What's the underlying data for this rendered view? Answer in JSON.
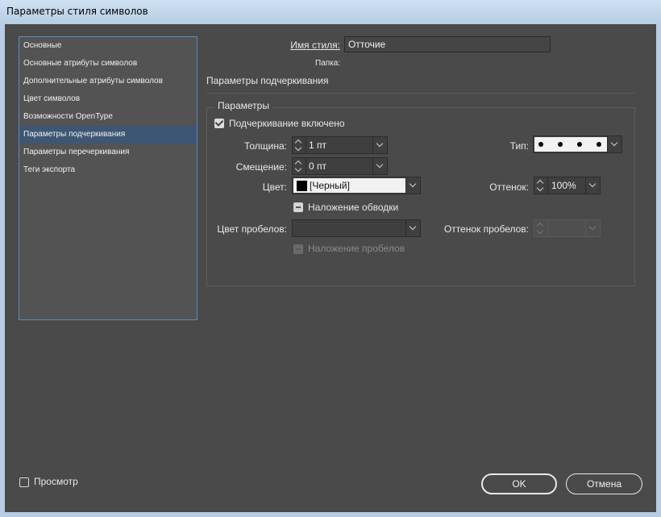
{
  "window": {
    "title": "Параметры стиля символов"
  },
  "sidebar": {
    "items": [
      {
        "label": "Основные",
        "selected": false
      },
      {
        "label": "Основные атрибуты символов",
        "selected": false
      },
      {
        "label": "Дополнительные атрибуты символов",
        "selected": false
      },
      {
        "label": "Цвет символов",
        "selected": false
      },
      {
        "label": "Возможности OpenType",
        "selected": false
      },
      {
        "label": "Параметры подчеркивания",
        "selected": true
      },
      {
        "label": "Параметры перечеркивания",
        "selected": false
      },
      {
        "label": "Теги экспорта",
        "selected": false
      }
    ]
  },
  "header": {
    "style_name_label": "Имя стиля:",
    "style_name_value": "Отточие",
    "folder_label": "Папка:",
    "section_title": "Параметры подчеркивания"
  },
  "params": {
    "group_title": "Параметры",
    "underline_on_label": "Подчеркивание включено",
    "underline_on": true,
    "weight_label": "Толщина:",
    "weight_value": "1 пт",
    "type_label": "Тип:",
    "offset_label": "Смещение:",
    "offset_value": "0 пт",
    "color_label": "Цвет:",
    "color_value": "[Черный]",
    "color_swatch": "#000000",
    "tint_label": "Оттенок:",
    "tint_value": "100%",
    "overprint_stroke_label": "Наложение обводки",
    "gap_color_label": "Цвет пробелов:",
    "gap_color_value": "",
    "gap_tint_label": "Оттенок пробелов:",
    "gap_tint_value": "",
    "overprint_gap_label": "Наложение пробелов"
  },
  "footer": {
    "preview_label": "Просмотр",
    "preview_checked": false,
    "ok_label": "OK",
    "cancel_label": "Отмена"
  },
  "colors": {
    "panel_bg": "#4a4a4a",
    "selection": "#3c5674",
    "sidebar_border": "#5a8ac8",
    "titlebar": "#c4d6ea"
  }
}
